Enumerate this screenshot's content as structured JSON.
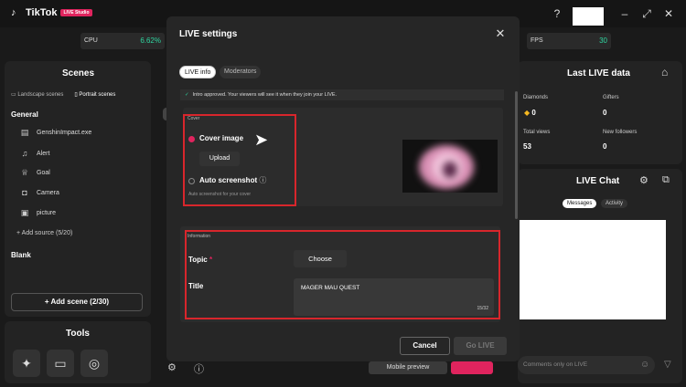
{
  "app": {
    "name": "TikTok",
    "badge": "LIVE Studio"
  },
  "stats": {
    "cpu_label": "CPU",
    "cpu_value": "6.62%",
    "fps_label": "FPS",
    "fps_value": "30"
  },
  "scenes": {
    "title": "Scenes",
    "tab_landscape": "Landscape scenes",
    "tab_portrait": "Portrait scenes",
    "group_general": "General",
    "sources": [
      {
        "label": "GenshinImpact.exe",
        "icon": "game-capture-icon"
      },
      {
        "label": "Alert",
        "icon": "bell-icon"
      },
      {
        "label": "Goal",
        "icon": "trophy-icon"
      },
      {
        "label": "Camera",
        "icon": "camera-icon"
      },
      {
        "label": "picture",
        "icon": "image-icon"
      }
    ],
    "add_source": "+ Add source (5/20)",
    "group_blank": "Blank",
    "add_scene": "+ Add scene (2/30)"
  },
  "tools": {
    "title": "Tools"
  },
  "last_live": {
    "title": "Last LIVE data",
    "diamonds_label": "Diamonds",
    "diamonds_value": "0",
    "gifters_label": "Gifters",
    "gifters_value": "0",
    "views_label": "Total views",
    "views_value": "53",
    "followers_label": "New followers",
    "followers_value": "0"
  },
  "live_chat": {
    "title": "LIVE Chat",
    "tab_messages": "Messages",
    "tab_activity": "Activity",
    "input_placeholder": "Comments only on LIVE"
  },
  "footer_bg": {
    "mobile_preview": "Mobile preview"
  },
  "modal": {
    "title": "LIVE settings",
    "tab_info": "LIVE info",
    "tab_moderators": "Moderators",
    "notice": "Intro approved. Your viewers will see it when they join your LIVE.",
    "cover": {
      "section_label": "Cover",
      "option_image": "Cover image",
      "upload": "Upload",
      "option_screenshot": "Auto screenshot",
      "screenshot_hint": "Auto screenshot for your cover"
    },
    "information": {
      "section_label": "Information",
      "topic_label": "Topic",
      "topic_required": "*",
      "choose": "Choose",
      "title_label": "Title",
      "title_value": "MAGER MAU QUEST",
      "title_counter": "15/32"
    },
    "cancel": "Cancel",
    "go_live": "Go LIVE"
  },
  "colors": {
    "accent_red": "#e0245e",
    "green": "#2fd5a0",
    "highlight_red": "#d8262c"
  }
}
